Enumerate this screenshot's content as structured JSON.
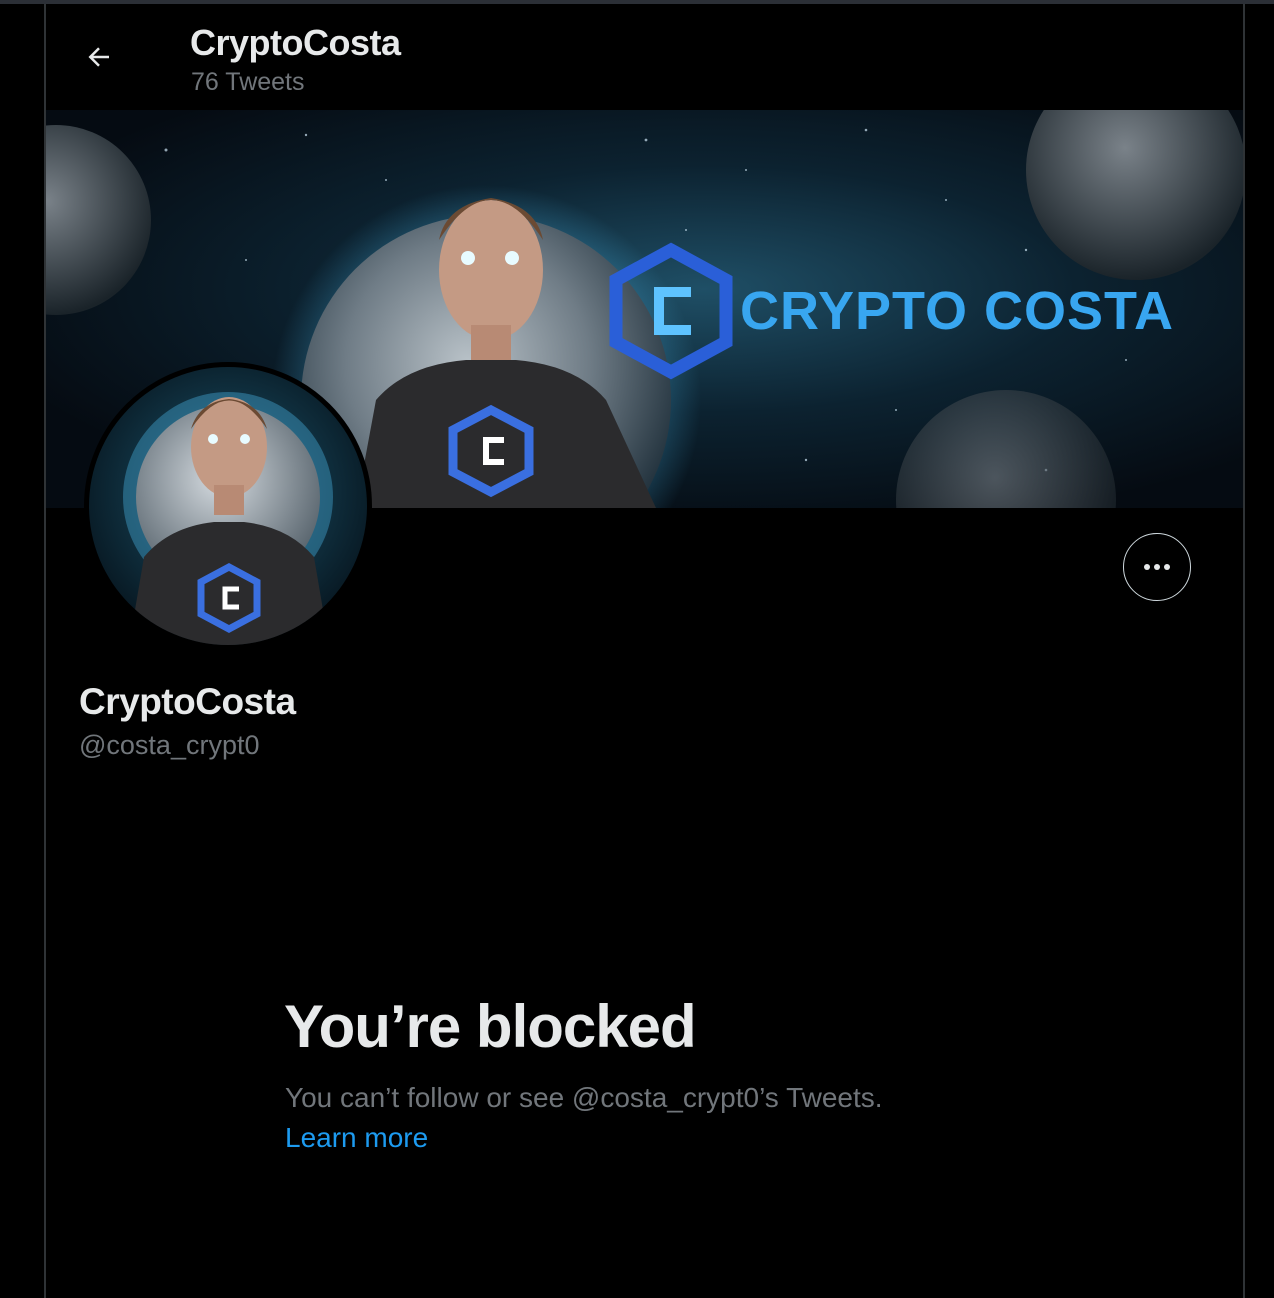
{
  "header": {
    "back_icon": "arrow-left-icon",
    "title": "CryptoCosta",
    "tweet_count": "76 Tweets"
  },
  "banner": {
    "brand_text": "CRYPTO COSTA",
    "logo_icon": "hexagon-c-logo"
  },
  "profile": {
    "name": "CryptoCosta",
    "handle": "@costa_crypt0",
    "more_icon": "ellipsis-icon"
  },
  "blocked": {
    "title": "You’re blocked",
    "message": "You can’t follow or see @costa_crypt0’s Tweets.",
    "link": "Learn more"
  },
  "colors": {
    "background": "#000000",
    "primary_text": "#e7e9ea",
    "secondary_text": "#71767b",
    "link": "#1d9bf0",
    "border": "#2f3336",
    "brand_blue": "#38a6f0"
  }
}
